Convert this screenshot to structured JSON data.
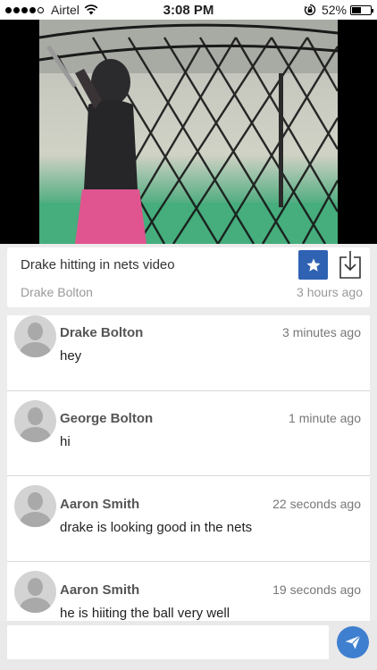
{
  "status_bar": {
    "carrier": "Airtel",
    "time": "3:08 PM",
    "battery_percent": "52%",
    "battery_level": 0.52,
    "signal_bars": 4
  },
  "video": {
    "title": "Drake hitting in nets video",
    "author": "Drake Bolton",
    "posted": "3 hours ago",
    "favorite_icon": "star-icon",
    "download_icon": "download-icon"
  },
  "comments": [
    {
      "name": "Drake Bolton",
      "time": "3 minutes ago",
      "text": "hey"
    },
    {
      "name": "George Bolton",
      "time": "1 minute ago",
      "text": "hi"
    },
    {
      "name": "Aaron Smith",
      "time": "22 seconds ago",
      "text": "drake is looking good in the nets"
    },
    {
      "name": "Aaron Smith",
      "time": "19 seconds ago",
      "text": "he is hiiting the ball very well"
    }
  ],
  "composer": {
    "value": "",
    "placeholder": "",
    "send_icon": "paper-plane-icon"
  },
  "colors": {
    "accent": "#2f62b3",
    "send": "#3f7fd0",
    "background": "#ececec"
  }
}
